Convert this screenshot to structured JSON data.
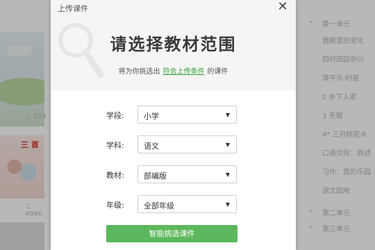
{
  "background": {
    "left_cards": [
      {
        "meta": "⊥ 158"
      },
      {
        "banner_text": "三 首",
        "meta": "⊥ 4990"
      }
    ],
    "tree": [
      {
        "label": "第一单元",
        "has_arrow": true
      },
      {
        "label": "我眼里的变化",
        "has_arrow": false
      },
      {
        "label": "四时田园杂兴",
        "has_arrow": false
      },
      {
        "label": "清平乐·村居",
        "has_arrow": false
      },
      {
        "label": "2 乡下人家",
        "has_arrow": false
      },
      {
        "label": "3 天窗",
        "has_arrow": false
      },
      {
        "label": "4* 三月桃花水",
        "has_arrow": false
      },
      {
        "label": "口语交际：转述",
        "has_arrow": false
      },
      {
        "label": "习作：我的乐园",
        "has_arrow": false
      },
      {
        "label": "语文园地",
        "has_arrow": false
      },
      {
        "label": "第二单元",
        "has_arrow": true
      },
      {
        "label": "第三单元",
        "has_arrow": true
      }
    ]
  },
  "modal": {
    "window_title": "上传课件",
    "close_glyph": "✕",
    "heading": "请选择教材范围",
    "subtitle_before": "将为你挑选出",
    "subtitle_link": "符合上传条件",
    "subtitle_after": "的课件",
    "fields": [
      {
        "label": "学段:",
        "value": "小学"
      },
      {
        "label": "学科:",
        "value": "语文"
      },
      {
        "label": "教材:",
        "value": "部编版"
      },
      {
        "label": "年级:",
        "value": "全部年级"
      }
    ],
    "dropdown_glyph": "▼",
    "submit_label": "智能挑选课件"
  },
  "colors": {
    "accent_green": "#5cb85c",
    "link_green": "#3aa33a",
    "overlay": "rgba(0,0,0,0.28)"
  }
}
